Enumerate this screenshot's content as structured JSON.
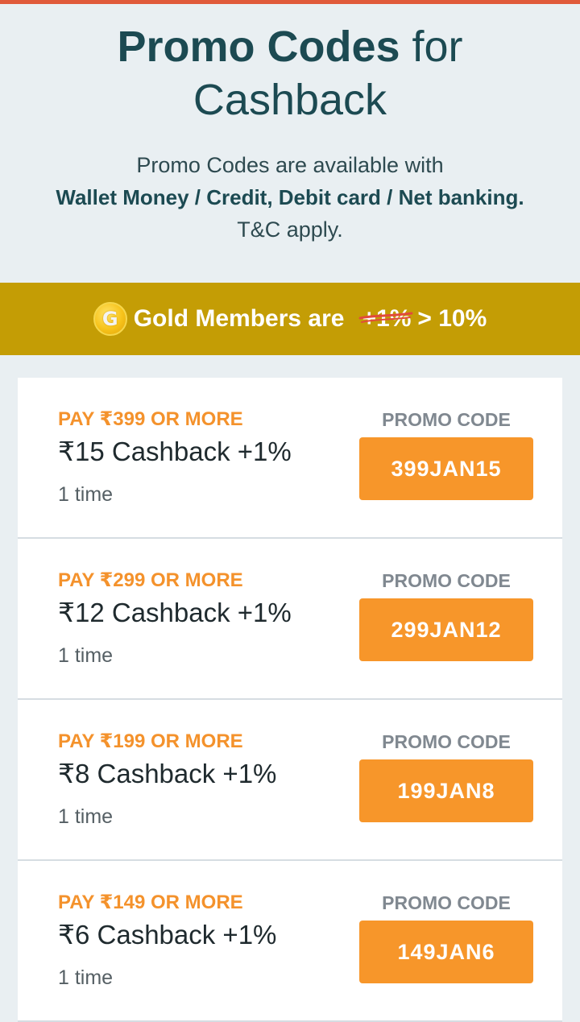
{
  "header": {
    "title_bold": "Promo Codes",
    "title_rest": " for",
    "title_line2": "Cashback",
    "subtitle_line1": "Promo Codes are available with",
    "subtitle_line2": "Wallet Money / Credit, Debit card / Net banking.",
    "subtitle_line3": "T&C apply."
  },
  "gold_banner": {
    "icon": "gold-coin-icon",
    "coin_letter": "G",
    "text": "Gold Members are",
    "old_value": "+1%",
    "new_value": "> 10%"
  },
  "promo_code_label": "PROMO CODE",
  "offers": [
    {
      "pay": "PAY ₹399 OR MORE",
      "cashback": "₹15 Cashback +1%",
      "times": "1 time",
      "code": "399JAN15"
    },
    {
      "pay": "PAY ₹299 OR MORE",
      "cashback": "₹12 Cashback +1%",
      "times": "1 time",
      "code": "299JAN12"
    },
    {
      "pay": "PAY ₹199 OR MORE",
      "cashback": "₹8 Cashback +1%",
      "times": "1 time",
      "code": "199JAN8"
    },
    {
      "pay": "PAY ₹149 OR MORE",
      "cashback": "₹6 Cashback +1%",
      "times": "1 time",
      "code": "149JAN6"
    }
  ],
  "colors": {
    "accent_orange": "#f7962a",
    "gold": "#c49d05",
    "title_teal": "#1c4a52",
    "top_bar": "#e05a3a"
  }
}
